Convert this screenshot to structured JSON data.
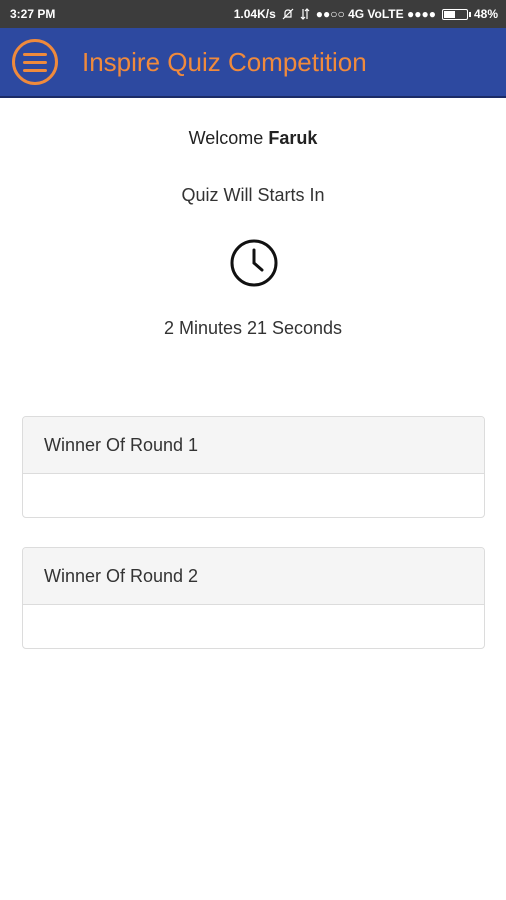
{
  "status_bar": {
    "time": "3:27 PM",
    "network_speed": "1.04K/s",
    "signal_text": "●●○○ 4G VoLTE ●●●●",
    "battery": "48%"
  },
  "app_bar": {
    "menu_icon": "hamburger-menu-icon",
    "title": "Inspire Quiz Competition",
    "background_color": "#2d49a0",
    "accent_color": "#f08a3c"
  },
  "main": {
    "welcome_prefix": "Welcome",
    "user_name": "Faruk",
    "starts_label": "Quiz Will Starts In",
    "clock_icon": "clock-icon",
    "countdown": "2 Minutes 21 Seconds"
  },
  "rounds": [
    {
      "title": "Winner Of Round 1",
      "winner": ""
    },
    {
      "title": "Winner Of Round 2",
      "winner": ""
    }
  ]
}
